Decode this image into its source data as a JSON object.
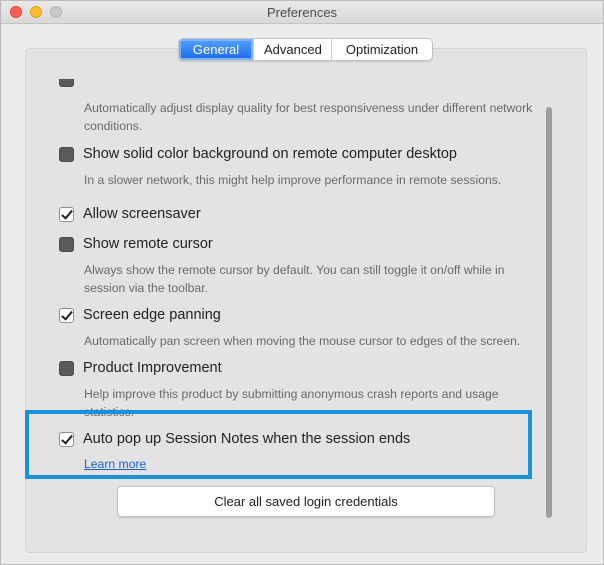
{
  "window": {
    "title": "Preferences"
  },
  "tabs": [
    {
      "label": "General",
      "active": true
    },
    {
      "label": "Advanced",
      "active": false
    },
    {
      "label": "Optimization",
      "active": false
    }
  ],
  "options": [
    {
      "description": "Automatically adjust display quality for best responsiveness under different network conditions."
    },
    {
      "label": "Show solid color background on remote computer desktop",
      "checked": false,
      "description": "In a slower network, this might help improve performance in remote sessions."
    },
    {
      "label": "Allow screensaver",
      "checked": true
    },
    {
      "label": "Show remote cursor",
      "checked": false,
      "description": "Always show the remote cursor by default. You can still toggle it on/off while in session via the toolbar."
    },
    {
      "label": "Screen edge panning",
      "checked": true,
      "description": "Automatically pan screen when moving the mouse cursor to edges of the screen."
    },
    {
      "label": "Product Improvement",
      "checked": false,
      "description": "Help improve this product by submitting anonymous crash reports and usage statistics."
    },
    {
      "label": "Auto pop up Session Notes when the session ends",
      "checked": true,
      "link": "Learn more"
    }
  ],
  "buttons": {
    "clear_credentials": "Clear all saved login credentials"
  },
  "colors": {
    "highlight": "#1792d8",
    "tab_active": "#1f6ff0",
    "link": "#1a5fd8"
  }
}
